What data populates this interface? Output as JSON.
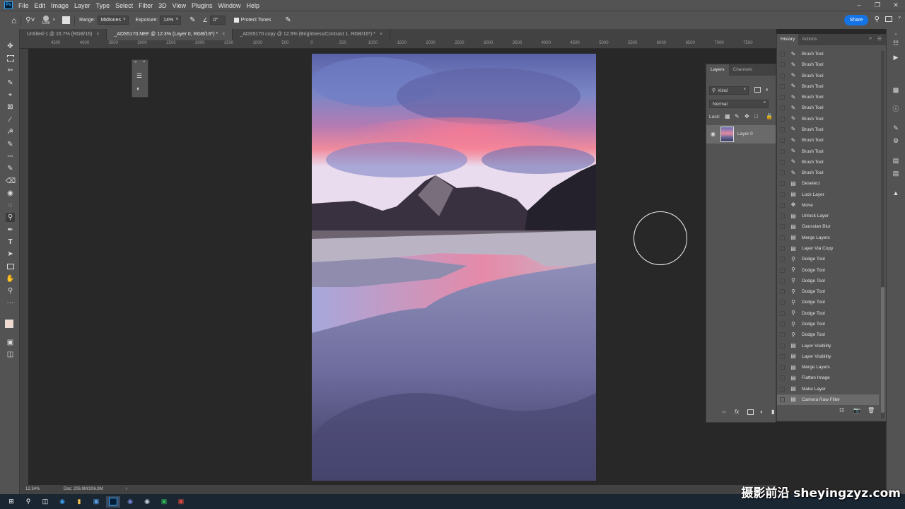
{
  "menubar": {
    "app_badge": "Ps",
    "items": [
      "File",
      "Edit",
      "Image",
      "Layer",
      "Type",
      "Select",
      "Filter",
      "3D",
      "View",
      "Plugins",
      "Window",
      "Help"
    ]
  },
  "options": {
    "brush_size": "1200",
    "range_label": "Range:",
    "range_value": "Midtones",
    "exposure_label": "Exposure:",
    "exposure_value": "14%",
    "angle_value": "0°",
    "protect_tones_label": "Protect Tones",
    "share_label": "Share"
  },
  "tabs": [
    {
      "label": "Untitled-1 @ 16.7% (RGB/16)"
    },
    {
      "label": "_ADS5170.NEF @ 12.3% (Layer 0, RGB/16*) *"
    },
    {
      "label": "_ADS5170 copy @ 12.5% (Brightness/Contrast 1, RGB/16*) *"
    }
  ],
  "ruler_ticks": [
    "4500",
    "4000",
    "3500",
    "3000",
    "2500",
    "2000",
    "1500",
    "1000",
    "500",
    "0",
    "500",
    "1000",
    "1500",
    "2000",
    "2500",
    "3000",
    "3500",
    "4000",
    "4500",
    "5000",
    "5500",
    "6000",
    "6500",
    "7000",
    "7500"
  ],
  "status": {
    "zoom": "12.34%",
    "doc": "Doc: 206.9M/206.9M"
  },
  "layers_panel": {
    "tab_layers": "Layers",
    "tab_channels": "Channels",
    "kind_label": "Kind",
    "blend_mode": "Normal",
    "lock_label": "Lock:",
    "layer_name": "Layer 0"
  },
  "history_panel": {
    "tab_history": "History",
    "tab_actions": "Actions",
    "items": [
      {
        "label": "Brush Tool",
        "icon": "brush"
      },
      {
        "label": "Brush Tool",
        "icon": "brush"
      },
      {
        "label": "Brush Tool",
        "icon": "brush"
      },
      {
        "label": "Brush Tool",
        "icon": "brush"
      },
      {
        "label": "Brush Tool",
        "icon": "brush"
      },
      {
        "label": "Brush Tool",
        "icon": "brush"
      },
      {
        "label": "Brush Tool",
        "icon": "brush"
      },
      {
        "label": "Brush Tool",
        "icon": "brush"
      },
      {
        "label": "Brush Tool",
        "icon": "brush"
      },
      {
        "label": "Brush Tool",
        "icon": "brush"
      },
      {
        "label": "Brush Tool",
        "icon": "brush"
      },
      {
        "label": "Brush Tool",
        "icon": "brush"
      },
      {
        "label": "Deselect",
        "icon": "doc"
      },
      {
        "label": "Lock Layer",
        "icon": "doc"
      },
      {
        "label": "Move",
        "icon": "move"
      },
      {
        "label": "Unlock Layer",
        "icon": "doc"
      },
      {
        "label": "Gaussian Blur",
        "icon": "doc"
      },
      {
        "label": "Merge Layers",
        "icon": "doc"
      },
      {
        "label": "Layer Via Copy",
        "icon": "doc"
      },
      {
        "label": "Dodge Tool",
        "icon": "dodge"
      },
      {
        "label": "Dodge Tool",
        "icon": "dodge"
      },
      {
        "label": "Dodge Tool",
        "icon": "dodge"
      },
      {
        "label": "Dodge Tool",
        "icon": "dodge"
      },
      {
        "label": "Dodge Tool",
        "icon": "dodge"
      },
      {
        "label": "Dodge Tool",
        "icon": "dodge"
      },
      {
        "label": "Dodge Tool",
        "icon": "dodge"
      },
      {
        "label": "Dodge Tool",
        "icon": "dodge"
      },
      {
        "label": "Layer Visibility",
        "icon": "doc"
      },
      {
        "label": "Layer Visibility",
        "icon": "doc"
      },
      {
        "label": "Merge Layers",
        "icon": "doc"
      },
      {
        "label": "Flatten Image",
        "icon": "doc"
      },
      {
        "label": "Make Layer",
        "icon": "doc"
      },
      {
        "label": "Camera Raw Filter",
        "icon": "doc"
      }
    ]
  },
  "watermark": "摄影前沿 sheyingzyz.com",
  "colors": {
    "panel": "#535353",
    "dark": "#282828",
    "accent": "#1473e6"
  }
}
